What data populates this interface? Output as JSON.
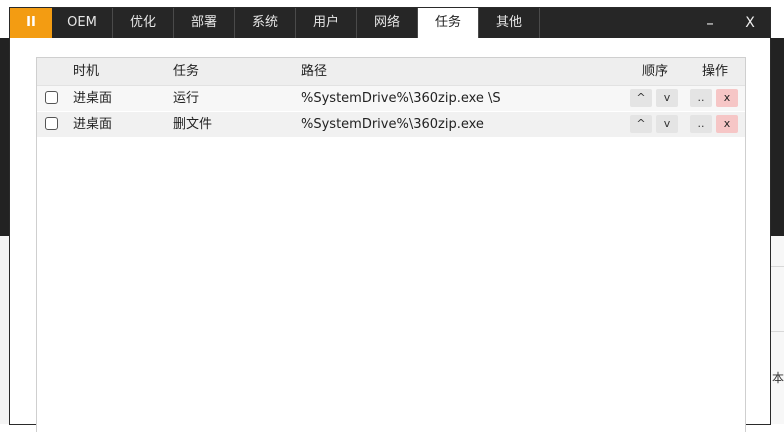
{
  "titlebar": {
    "menu_label": "II",
    "tabs": [
      {
        "label": "OEM"
      },
      {
        "label": "优化"
      },
      {
        "label": "部署"
      },
      {
        "label": "系统"
      },
      {
        "label": "用户"
      },
      {
        "label": "网络"
      },
      {
        "label": "任务",
        "active": true
      },
      {
        "label": "其他"
      }
    ],
    "minimize_label": "–",
    "close_label": "X"
  },
  "table": {
    "columns": {
      "time": "时机",
      "task": "任务",
      "path": "路径",
      "order": "顺序",
      "actions": "操作"
    },
    "rows": [
      {
        "checked": false,
        "time": "进桌面",
        "task": "运行",
        "path": "%SystemDrive%\\360zip.exe \\S",
        "up": "^",
        "down": "v",
        "more": "..",
        "delete": "x"
      },
      {
        "checked": false,
        "time": "进桌面",
        "task": "删文件",
        "path": "%SystemDrive%\\360zip.exe",
        "up": "^",
        "down": "v",
        "more": "..",
        "delete": "x"
      }
    ]
  },
  "background": {
    "right_char": "本"
  },
  "colors": {
    "titlebar": "#262626",
    "accent": "#f39c12",
    "active_tab": "#ffffff",
    "delete_button": "#f6c6c6"
  }
}
